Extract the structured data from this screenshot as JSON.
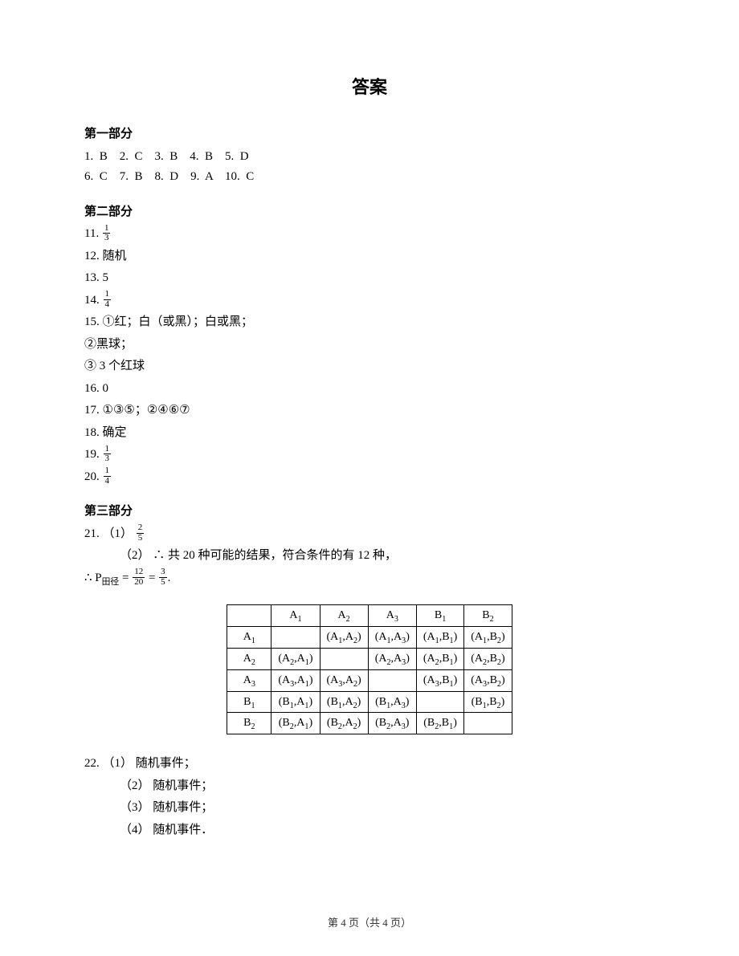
{
  "title": "答案",
  "sections": {
    "part1": {
      "heading": "第一部分",
      "row1": "1.  B    2.  C    3.  B    4.  B    5.  D",
      "row2": "6.  C    7.  B    8.  D    9.  A    10.  C"
    },
    "part2": {
      "heading": "第二部分",
      "a11_num": "11. ",
      "a11_frac": {
        "n": "1",
        "d": "3"
      },
      "a12": "12.  随机",
      "a13": "13.   5",
      "a14_num": "14. ",
      "a14_frac": {
        "n": "1",
        "d": "4"
      },
      "a15a": "15.    ①红；白（或黑）；白或黑；",
      "a15b": "②黑球；",
      "a15c": "③  3 个红球",
      "a16": "16.   0",
      "a17": "17.    ①③⑤；②④⑥⑦",
      "a18": "18.  确定",
      "a19_num": "19. ",
      "a19_frac": {
        "n": "1",
        "d": "3"
      },
      "a20_num": "20. ",
      "a20_frac": {
        "n": "1",
        "d": "4"
      }
    },
    "part3": {
      "heading": "第三部分",
      "a21_1_prefix": "21. （1）  ",
      "a21_1_frac": {
        "n": "2",
        "d": "5"
      },
      "a21_2": "（2）   ∴ 共 20 种可能的结果，符合条件的有 12 种，",
      "a21_eq_prefix": "∴ P",
      "a21_eq_sub": "田径",
      "a21_eq_mid1": " = ",
      "a21_eq_f1": {
        "n": "12",
        "d": "20"
      },
      "a21_eq_mid2": " = ",
      "a21_eq_f2": {
        "n": "3",
        "d": "5"
      },
      "a21_eq_end": ".",
      "table": {
        "headers": [
          "",
          "A1",
          "A2",
          "A3",
          "B1",
          "B2"
        ],
        "rows": [
          [
            "A1",
            "",
            "(A1,A2)",
            "(A1,A3)",
            "(A1,B1)",
            "(A1,B2)"
          ],
          [
            "A2",
            "(A2,A1)",
            "",
            "(A2,A3)",
            "(A2,B1)",
            "(A2,B2)"
          ],
          [
            "A3",
            "(A3,A1)",
            "(A3,A2)",
            "",
            "(A3,B1)",
            "(A3,B2)"
          ],
          [
            "B1",
            "(B1,A1)",
            "(B1,A2)",
            "(B1,A3)",
            "",
            "(B1,B2)"
          ],
          [
            "B2",
            "(B2,A1)",
            "(B2,A2)",
            "(B2,A3)",
            "(B2,B1)",
            ""
          ]
        ]
      },
      "a22_1": "22. （1）  随机事件；",
      "a22_2": "（2）  随机事件；",
      "a22_3": "（3）  随机事件；",
      "a22_4": "（4）  随机事件．",
      "a22_sub_indent": 44
    }
  },
  "footer": {
    "prefix": "第 ",
    "page": "4",
    "mid": " 页（共 ",
    "total": "4",
    "suffix": " 页）"
  }
}
